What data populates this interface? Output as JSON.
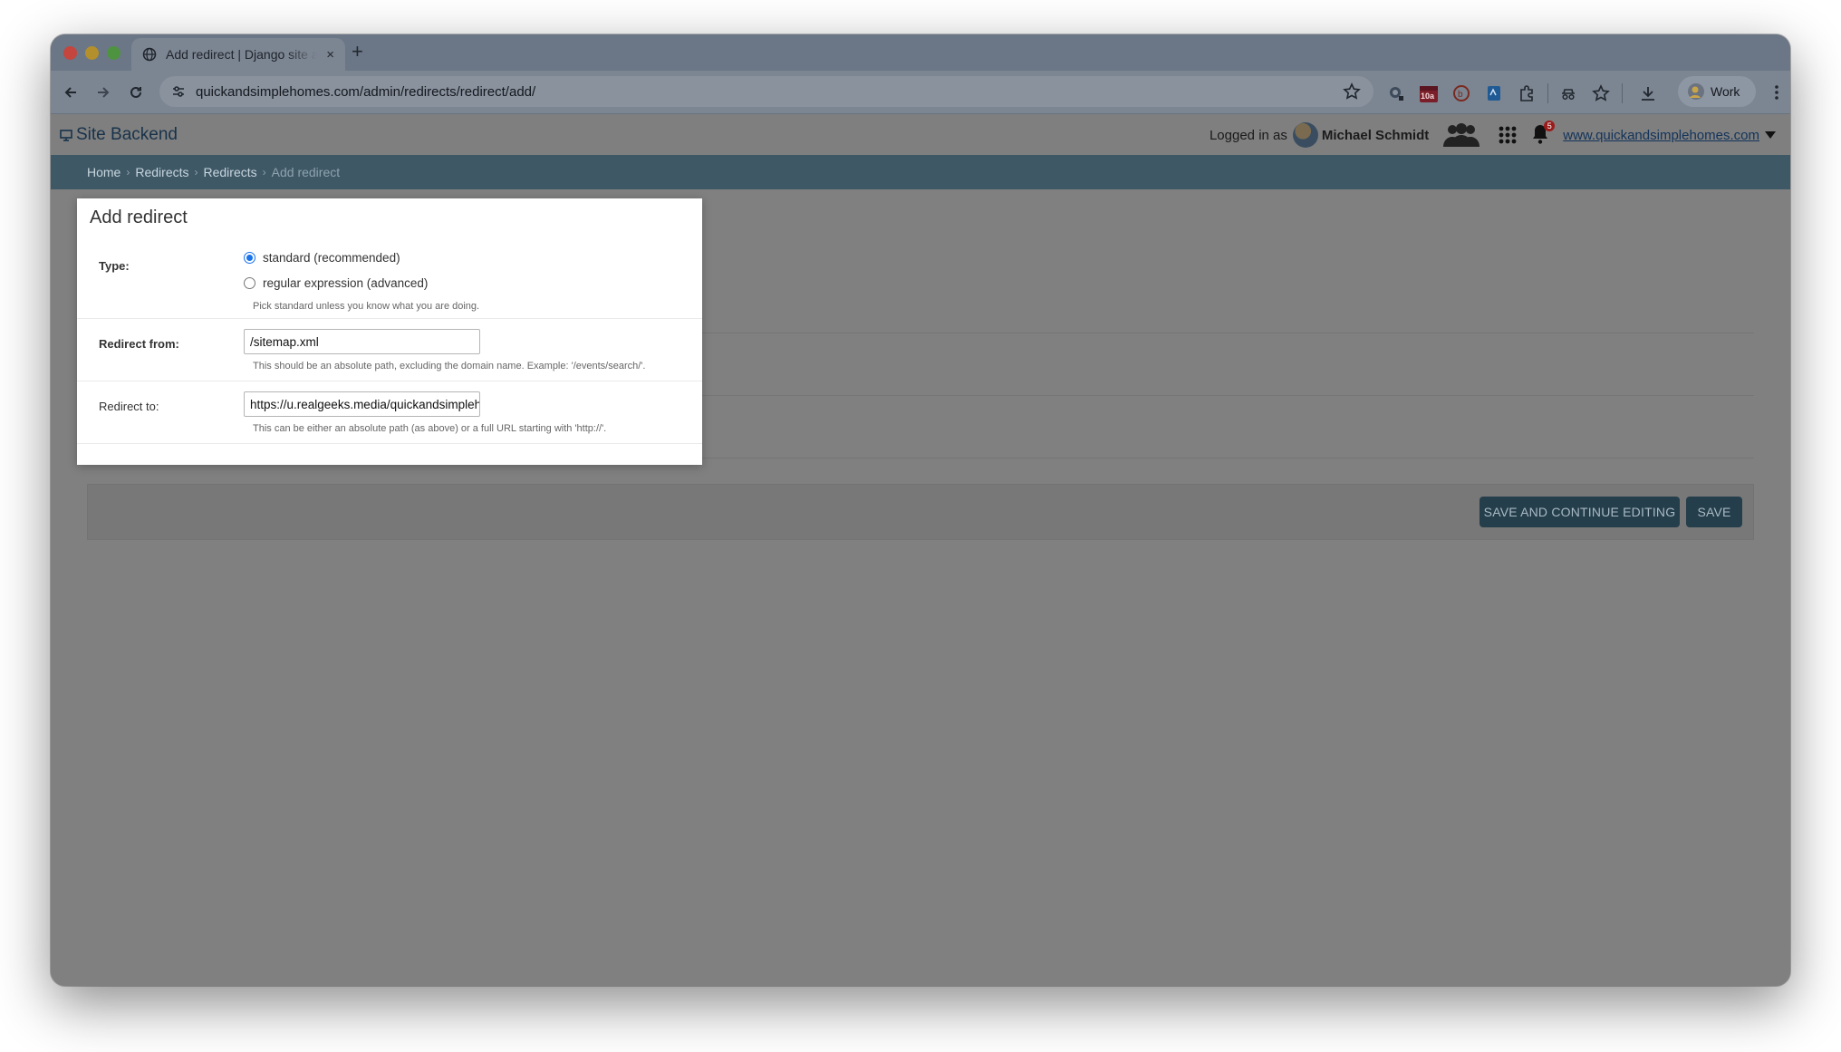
{
  "browser": {
    "tab_title": "Add redirect | Django site admin",
    "new_tab": "+",
    "tab_close": "×",
    "url": "quickandsimplehomes.com/admin/redirects/redirect/add/",
    "extension_badge": "10a",
    "profile_label": "Work"
  },
  "header": {
    "brand": "Site Backend",
    "logged_in_prefix": "Logged in as",
    "user_name": "Michael Schmidt",
    "notification_count": "5",
    "site_link": "www.quickandsimplehomes.com"
  },
  "breadcrumbs": {
    "items": [
      "Home",
      "Redirects",
      "Redirects"
    ],
    "separator": "›",
    "current": "Add redirect"
  },
  "form": {
    "title": "Add redirect",
    "type": {
      "label": "Type:",
      "options": [
        "standard (recommended)",
        "regular expression (advanced)"
      ],
      "selected": "standard (recommended)",
      "help": "Pick standard unless you know what you are doing."
    },
    "redirect_from": {
      "label": "Redirect from:",
      "value": "/sitemap.xml",
      "help": "This should be an absolute path, excluding the domain name. Example: '/events/search/'."
    },
    "redirect_to": {
      "label": "Redirect to:",
      "value": "https://u.realgeeks.media/quickandsimplehomes/sitemap.xml",
      "help": "This can be either an absolute path (as above) or a full URL starting with 'http://'."
    }
  },
  "actions": {
    "save_continue": "SAVE AND CONTINUE EDITING",
    "save": "SAVE"
  },
  "colors": {
    "breadcrumb_bar": "#3f5866",
    "button": "#253e4b",
    "radio_accent": "#1a73e8",
    "link": "#12335b"
  }
}
